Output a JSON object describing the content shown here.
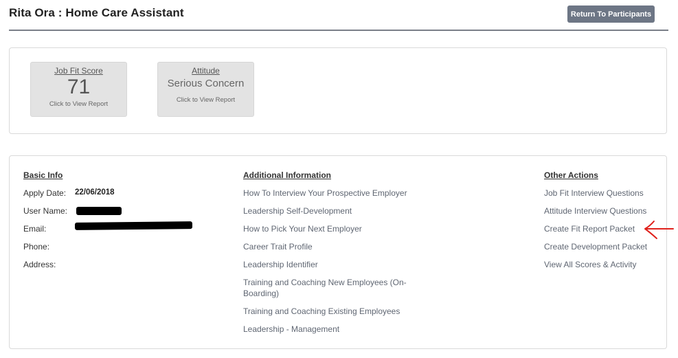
{
  "header": {
    "title": "Rita Ora : Home Care Assistant",
    "return_button": "Return To Participants"
  },
  "scores": {
    "job_fit": {
      "title": "Job Fit Score",
      "value": "71",
      "sub": "Click to View Report"
    },
    "attitude": {
      "title": "Attitude",
      "value": "Serious Concern",
      "sub": "Click to View Report"
    }
  },
  "basic_info": {
    "heading": "Basic Info",
    "apply_date_label": "Apply Date:",
    "apply_date_value": "22/06/2018",
    "user_name_label": "User Name:",
    "email_label": "Email:",
    "phone_label": "Phone:",
    "address_label": "Address:"
  },
  "additional_info": {
    "heading": "Additional Information",
    "links": [
      "How To Interview Your Prospective Employer",
      "Leadership Self-Development",
      "How to Pick Your Next Employer",
      "Career Trait Profile",
      "Leadership Identifier",
      "Training and Coaching New Employees (On-",
      "Boarding)",
      "Training and Coaching Existing Employees",
      "Leadership - Management"
    ]
  },
  "other_actions": {
    "heading": "Other Actions",
    "links": [
      "Job Fit Interview Questions",
      "Attitude Interview Questions",
      "Create Fit Report Packet",
      "Create Development Packet",
      "View All Scores & Activity"
    ]
  },
  "colors": {
    "button_bg": "#6d7685",
    "card_bg": "#e3e3e3",
    "link": "#5f6672",
    "annotation_arrow": "#e0201b"
  },
  "icons": {
    "annotation": "red-arrow-icon"
  }
}
